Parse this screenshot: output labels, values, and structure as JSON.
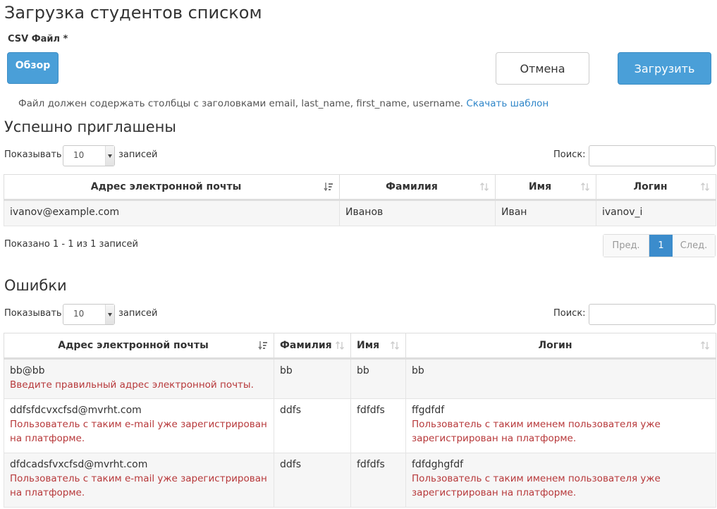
{
  "page": {
    "title": "Загрузка студентов списком"
  },
  "upload": {
    "csv_label": "CSV Файл *",
    "browse": "Обзор",
    "cancel": "Отмена",
    "submit": "Загрузить",
    "hint": "Файл должен содержать столбцы с заголовками email, last_name, first_name, username.",
    "template_link": "Скачать шаблон"
  },
  "invited": {
    "title": "Успешно приглашены",
    "show_label": "Показывать",
    "page_size": "10",
    "entries_label": "записей",
    "search_label": "Поиск:",
    "columns": [
      "Адрес электронной почты",
      "Фамилия",
      "Имя",
      "Логин"
    ],
    "rows": [
      {
        "email": "ivanov@example.com",
        "last_name": "Иванов",
        "first_name": "Иван",
        "username": "ivanov_i"
      }
    ],
    "info": "Показано 1 - 1 из 1 записей",
    "pager": {
      "prev": "Пред.",
      "current": "1",
      "next": "След."
    }
  },
  "errors": {
    "title": "Ошибки",
    "show_label": "Показывать",
    "page_size": "10",
    "entries_label": "записей",
    "search_label": "Поиск:",
    "columns": [
      "Адрес электронной почты",
      "Фамилия",
      "Имя",
      "Логин"
    ],
    "rows": [
      {
        "email": "bb@bb",
        "email_error": "Введите правильный адрес электронной почты.",
        "last_name": "bb",
        "first_name": "bb",
        "username": "bb",
        "username_error": ""
      },
      {
        "email": "ddfsfdcvxcfsd@mvrht.com",
        "email_error": "Пользователь с таким e-mail уже зарегистрирован на платформе.",
        "last_name": "ddfs",
        "first_name": "fdfdfs",
        "username": "ffgdfdf",
        "username_error": "Пользователь с таким именем пользователя уже зарегистрирован на платформе."
      },
      {
        "email": "dfdcadsfvxcfsd@mvrht.com",
        "email_error": "Пользователь с таким e-mail уже зарегистрирован на платформе.",
        "last_name": "ddfs",
        "first_name": "fdfdfs",
        "username": "fdfdghgfdf",
        "username_error": "Пользователь с таким именем пользователя уже зарегистрирован на платформе."
      }
    ]
  },
  "colors": {
    "primary": "#4a9fd8",
    "error": "#b7383a",
    "link": "#2f86c9",
    "pager_active": "#3b8ccc"
  },
  "icons": {
    "sort_active": "sort-amount-down-icon",
    "sort_both": "sort-arrows-icon"
  }
}
